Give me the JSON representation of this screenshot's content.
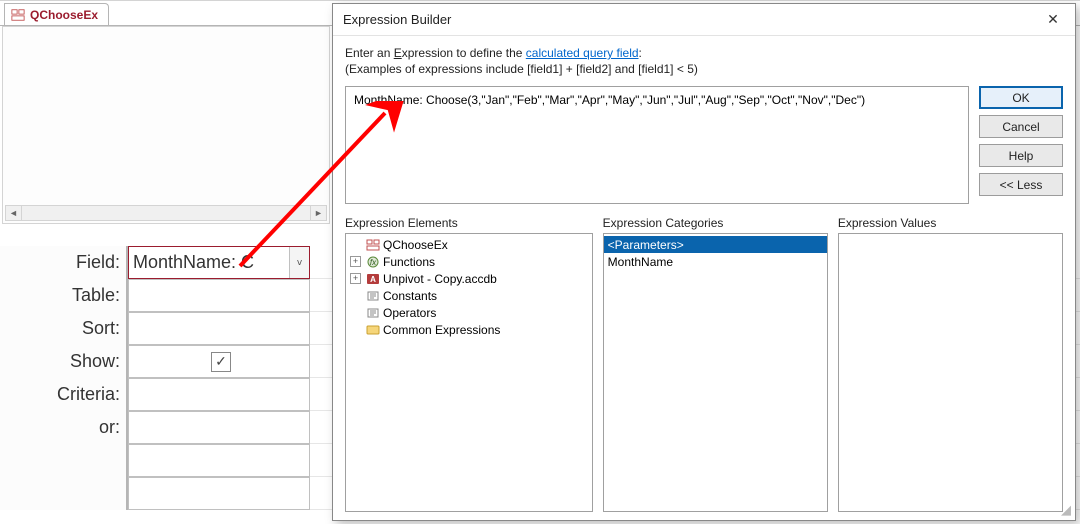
{
  "tab": {
    "label": "QChooseEx"
  },
  "query_grid": {
    "labels": {
      "field": "Field:",
      "table": "Table:",
      "sort": "Sort:",
      "show": "Show:",
      "criteria": "Criteria:",
      "or": "or:"
    },
    "field_value": "MonthName: C",
    "show_checked": true
  },
  "dialog": {
    "title": "Expression Builder",
    "intro_prefix": "Enter an ",
    "intro_underline": "E",
    "intro_mid": "xpression to define the ",
    "intro_link": "calculated query field",
    "intro_suffix": ":",
    "example": "(Examples of expressions include [field1] + [field2] and [field1] < 5)",
    "expression": "MonthName: Choose(3,\"Jan\",\"Feb\",\"Mar\",\"Apr\",\"May\",\"Jun\",\"Jul\",\"Aug\",\"Sep\",\"Oct\",\"Nov\",\"Dec\")",
    "buttons": {
      "ok": "OK",
      "cancel": "Cancel",
      "help": "Help",
      "less": "<< Less"
    },
    "panels": {
      "elements_label": "Expression Elements",
      "categories_label": "Expression Categories",
      "values_label": "Expression Values"
    },
    "elements": {
      "root": "QChooseEx",
      "functions": "Functions",
      "db": "Unpivot - Copy.accdb",
      "constants": "Constants",
      "operators": "Operators",
      "common": "Common Expressions"
    },
    "categories": {
      "parameters": "<Parameters>",
      "monthname": "MonthName"
    }
  },
  "annotation": {
    "arrow_color": "#ff0000"
  }
}
